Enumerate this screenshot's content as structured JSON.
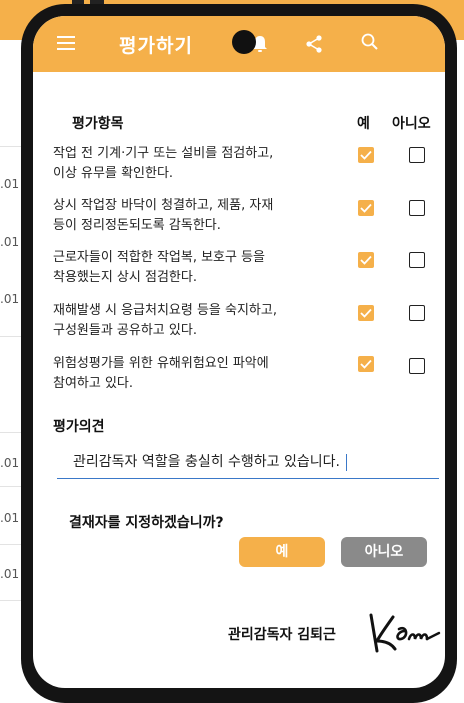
{
  "app": {
    "title": "평가하기",
    "icons": [
      "menu-icon",
      "bell-icon",
      "share-icon",
      "search-icon"
    ],
    "accent_color": "#f5b04a"
  },
  "background": {
    "row_numbers": [
      ".01",
      ".01",
      ".01",
      ".01",
      ".01",
      ".01"
    ]
  },
  "evaluation": {
    "section_title": "평가항목",
    "yes_header": "예",
    "no_header": "아니오",
    "items": [
      {
        "line1": "작업 전 기계·기구 또는 설비를 점검하고,",
        "line2": "이상 유무를 확인한다.",
        "yes": true,
        "no": false
      },
      {
        "line1": "상시 작업장 바닥이 청결하고, 제품, 자재",
        "line2": "등이 정리정돈되도록 감독한다.",
        "yes": true,
        "no": false
      },
      {
        "line1": "근로자들이 적합한 작업복, 보호구 등을",
        "line2": "착용했는지 상시 점검한다.",
        "yes": true,
        "no": false
      },
      {
        "line1": "재해발생 시 응급처치요령 등을 숙지하고,",
        "line2": "구성원들과 공유하고 있다.",
        "yes": true,
        "no": false
      },
      {
        "line1": "위험성평가를 위한 유해위험요인 파악에",
        "line2": "참여하고 있다.",
        "yes": true,
        "no": false
      }
    ]
  },
  "opinion": {
    "title": "평가의견",
    "value": "관리감독자 역할을 충실히 수행하고 있습니다."
  },
  "approver": {
    "question": "결재자를 지정하겠습니까?",
    "yes_label": "예",
    "no_label": "아니오"
  },
  "signature": {
    "signer": "관리감독자 김퇴근",
    "signature_image_text": "Kim"
  }
}
